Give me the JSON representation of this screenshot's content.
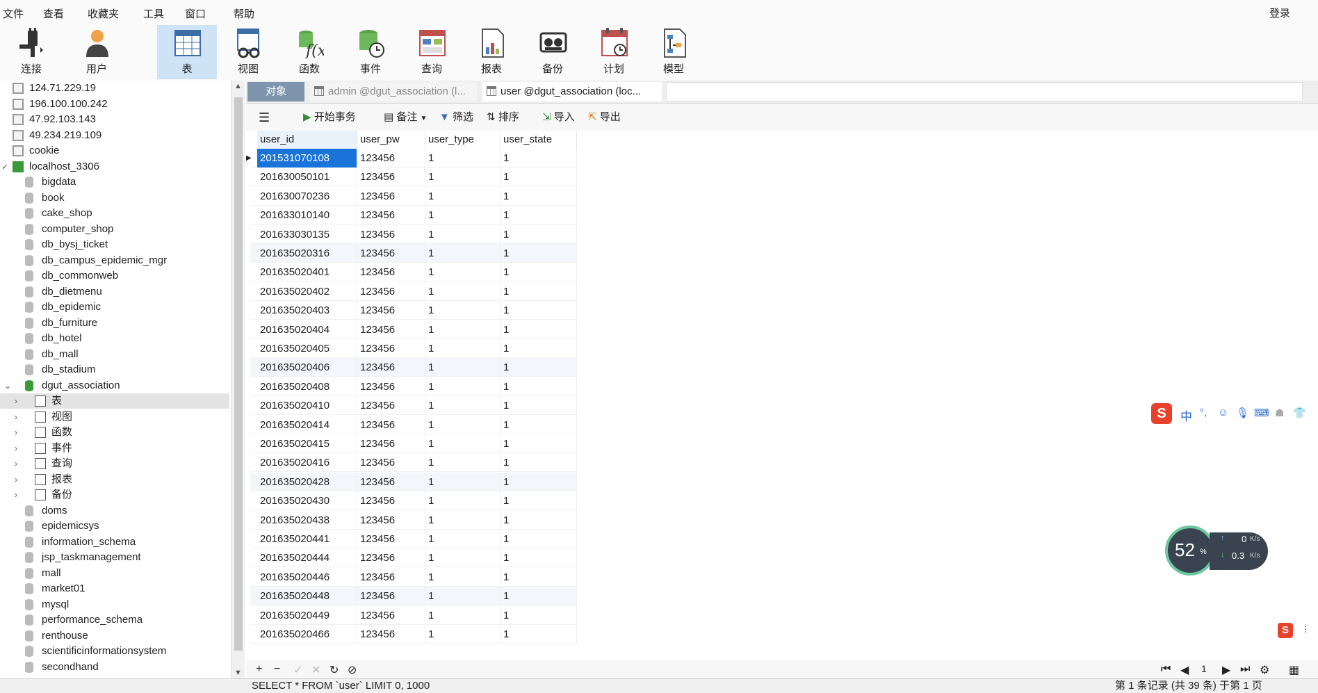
{
  "menu": [
    "文件",
    "查看",
    "收藏夹",
    "工具",
    "窗口",
    "帮助"
  ],
  "login": "登录",
  "toolbar": [
    {
      "label": "连接",
      "icon": "plug-icon"
    },
    {
      "label": "用户",
      "icon": "user-icon"
    },
    {
      "label": "表",
      "icon": "table-icon",
      "active": true
    },
    {
      "label": "视图",
      "icon": "view-icon"
    },
    {
      "label": "函数",
      "icon": "function-icon"
    },
    {
      "label": "事件",
      "icon": "event-icon"
    },
    {
      "label": "查询",
      "icon": "query-icon"
    },
    {
      "label": "报表",
      "icon": "report-icon"
    },
    {
      "label": "备份",
      "icon": "backup-icon"
    },
    {
      "label": "计划",
      "icon": "schedule-icon"
    },
    {
      "label": "模型",
      "icon": "model-icon"
    }
  ],
  "tree": [
    {
      "label": "124.71.229.19",
      "type": "conn",
      "level": 0
    },
    {
      "label": "196.100.100.242",
      "type": "conn",
      "level": 0
    },
    {
      "label": "47.92.103.143",
      "type": "conn",
      "level": 0
    },
    {
      "label": "49.234.219.109",
      "type": "conn",
      "level": 0
    },
    {
      "label": "cookie",
      "type": "conn",
      "level": 0
    },
    {
      "label": "localhost_3306",
      "type": "conn-open",
      "level": 0,
      "arrow": "✓"
    },
    {
      "label": "bigdata",
      "type": "db",
      "level": 1
    },
    {
      "label": "book",
      "type": "db",
      "level": 1
    },
    {
      "label": "cake_shop",
      "type": "db",
      "level": 1
    },
    {
      "label": "computer_shop",
      "type": "db",
      "level": 1
    },
    {
      "label": "db_bysj_ticket",
      "type": "db",
      "level": 1
    },
    {
      "label": "db_campus_epidemic_mgr",
      "type": "db",
      "level": 1
    },
    {
      "label": "db_commonweb",
      "type": "db",
      "level": 1
    },
    {
      "label": "db_dietmenu",
      "type": "db",
      "level": 1
    },
    {
      "label": "db_epidemic",
      "type": "db",
      "level": 1
    },
    {
      "label": "db_furniture",
      "type": "db",
      "level": 1
    },
    {
      "label": "db_hotel",
      "type": "db",
      "level": 1
    },
    {
      "label": "db_mall",
      "type": "db",
      "level": 1
    },
    {
      "label": "db_stadium",
      "type": "db",
      "level": 1
    },
    {
      "label": "dgut_association",
      "type": "db-open",
      "level": 1,
      "arrow": "⌄"
    },
    {
      "label": "表",
      "type": "tables",
      "level": 2,
      "arrow": "›",
      "selected": true
    },
    {
      "label": "视图",
      "type": "views",
      "level": 2,
      "arrow": "›"
    },
    {
      "label": "函数",
      "type": "funcs",
      "level": 2,
      "arrow": "›"
    },
    {
      "label": "事件",
      "type": "events",
      "level": 2,
      "arrow": "›"
    },
    {
      "label": "查询",
      "type": "queries",
      "level": 2,
      "arrow": "›"
    },
    {
      "label": "报表",
      "type": "reports",
      "level": 2,
      "arrow": "›"
    },
    {
      "label": "备份",
      "type": "backups",
      "level": 2,
      "arrow": "›"
    },
    {
      "label": "doms",
      "type": "db",
      "level": 1
    },
    {
      "label": "epidemicsys",
      "type": "db",
      "level": 1
    },
    {
      "label": "information_schema",
      "type": "db",
      "level": 1
    },
    {
      "label": "jsp_taskmanagement",
      "type": "db",
      "level": 1
    },
    {
      "label": "mall",
      "type": "db",
      "level": 1
    },
    {
      "label": "market01",
      "type": "db",
      "level": 1
    },
    {
      "label": "mysql",
      "type": "db",
      "level": 1
    },
    {
      "label": "performance_schema",
      "type": "db",
      "level": 1
    },
    {
      "label": "renthouse",
      "type": "db",
      "level": 1
    },
    {
      "label": "scientificinformationsystem",
      "type": "db",
      "level": 1
    },
    {
      "label": "secondhand",
      "type": "db",
      "level": 1
    }
  ],
  "tabs": {
    "objects": "对象",
    "tab1": "admin @dgut_association (l...",
    "tab2": "user @dgut_association (loc..."
  },
  "grid_toolbar": {
    "begin_tx": "开始事务",
    "memo": "备注",
    "filter": "筛选",
    "sort": "排序",
    "import": "导入",
    "export": "导出"
  },
  "columns": [
    "user_id",
    "user_pw",
    "user_type",
    "user_state"
  ],
  "rows": [
    [
      "201531070108",
      "123456",
      "1",
      "1"
    ],
    [
      "201630050101",
      "123456",
      "1",
      "1"
    ],
    [
      "201630070236",
      "123456",
      "1",
      "1"
    ],
    [
      "201633010140",
      "123456",
      "1",
      "1"
    ],
    [
      "201633030135",
      "123456",
      "1",
      "1"
    ],
    [
      "201635020316",
      "123456",
      "1",
      "1"
    ],
    [
      "201635020401",
      "123456",
      "1",
      "1"
    ],
    [
      "201635020402",
      "123456",
      "1",
      "1"
    ],
    [
      "201635020403",
      "123456",
      "1",
      "1"
    ],
    [
      "201635020404",
      "123456",
      "1",
      "1"
    ],
    [
      "201635020405",
      "123456",
      "1",
      "1"
    ],
    [
      "201635020406",
      "123456",
      "1",
      "1"
    ],
    [
      "201635020408",
      "123456",
      "1",
      "1"
    ],
    [
      "201635020410",
      "123456",
      "1",
      "1"
    ],
    [
      "201635020414",
      "123456",
      "1",
      "1"
    ],
    [
      "201635020415",
      "123456",
      "1",
      "1"
    ],
    [
      "201635020416",
      "123456",
      "1",
      "1"
    ],
    [
      "201635020428",
      "123456",
      "1",
      "1"
    ],
    [
      "201635020430",
      "123456",
      "1",
      "1"
    ],
    [
      "201635020438",
      "123456",
      "1",
      "1"
    ],
    [
      "201635020441",
      "123456",
      "1",
      "1"
    ],
    [
      "201635020444",
      "123456",
      "1",
      "1"
    ],
    [
      "201635020446",
      "123456",
      "1",
      "1"
    ],
    [
      "201635020448",
      "123456",
      "1",
      "1"
    ],
    [
      "201635020449",
      "123456",
      "1",
      "1"
    ],
    [
      "201635020466",
      "123456",
      "1",
      "1"
    ]
  ],
  "pager": {
    "page": "1"
  },
  "status": {
    "sql": "SELECT * FROM `user` LIMIT 0, 1000",
    "records": "第 1 条记录 (共 39 条) 于第 1 页"
  },
  "ime": {
    "lang": "中"
  },
  "speed": {
    "percent": "52",
    "unit": "%",
    "up": "0",
    "up_unit": "K/s",
    "down": "0.3",
    "down_unit": "K/s"
  },
  "colors": {
    "accent": "#1a73d9",
    "tab_objects": "#7e95ad",
    "toolbar_active": "#cfe3f7"
  }
}
